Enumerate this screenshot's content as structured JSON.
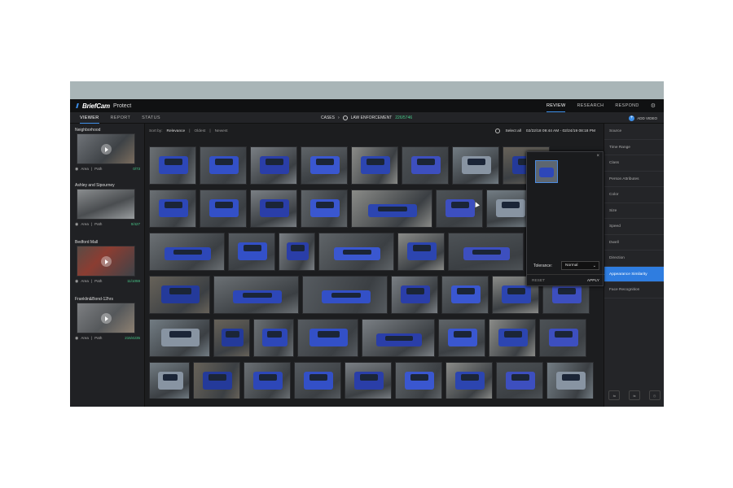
{
  "app": {
    "brand": "BriefCam",
    "product": "Protect"
  },
  "topnav": [
    {
      "label": "REVIEW",
      "active": true
    },
    {
      "label": "RESEARCH",
      "active": false
    },
    {
      "label": "RESPOND",
      "active": false
    }
  ],
  "tabs": [
    {
      "label": "VIEWER",
      "active": true
    },
    {
      "label": "REPORT",
      "active": false
    },
    {
      "label": "STATUS",
      "active": false
    }
  ],
  "breadcrumb": {
    "cases": "CASES",
    "separator": "›",
    "case": "LAW ENFORCEMENT",
    "count": "226/5746"
  },
  "add_video": "ADD VIDEO",
  "cameras": [
    {
      "name": "Neighborhood",
      "area": "Area",
      "path": "Path",
      "stat": "0/73"
    },
    {
      "name": "Ashley and Sipourney",
      "area": "Area",
      "path": "Path",
      "stat": "0/427"
    },
    {
      "name": "Bedford Mall",
      "area": "Area",
      "path": "Path",
      "stat": "11/1059"
    },
    {
      "name": "Franklin&Bond-12hrs",
      "area": "Area",
      "path": "Path",
      "stat": "215/4235"
    }
  ],
  "sort": {
    "label": "Sort by:",
    "options": [
      "Relevance",
      "Oldest",
      "Newest"
    ],
    "active": "Relevance"
  },
  "select_all": "Select all",
  "date_range": "02/22/18 09:44 AM - 02/24/19 08:18 PM",
  "filters": [
    {
      "label": "Source",
      "active": false
    },
    {
      "label": "Time Range",
      "active": false
    },
    {
      "label": "Class",
      "active": false
    },
    {
      "label": "Person Attributes",
      "active": false
    },
    {
      "label": "Color",
      "active": false
    },
    {
      "label": "Size",
      "active": false
    },
    {
      "label": "Speed",
      "active": false
    },
    {
      "label": "Dwell",
      "active": false
    },
    {
      "label": "Direction",
      "active": false
    },
    {
      "label": "Appearance Similarity",
      "active": true
    },
    {
      "label": "Face Recognition",
      "active": false
    }
  ],
  "popup": {
    "tolerance_label": "Tolerance:",
    "tolerance_value": "Normal",
    "reset": "RESET",
    "apply": "APPLY",
    "close": "×"
  },
  "colors": {
    "accent": "#2f7de0",
    "car_blue": "#2d47b8",
    "count_green": "#48c98a"
  }
}
